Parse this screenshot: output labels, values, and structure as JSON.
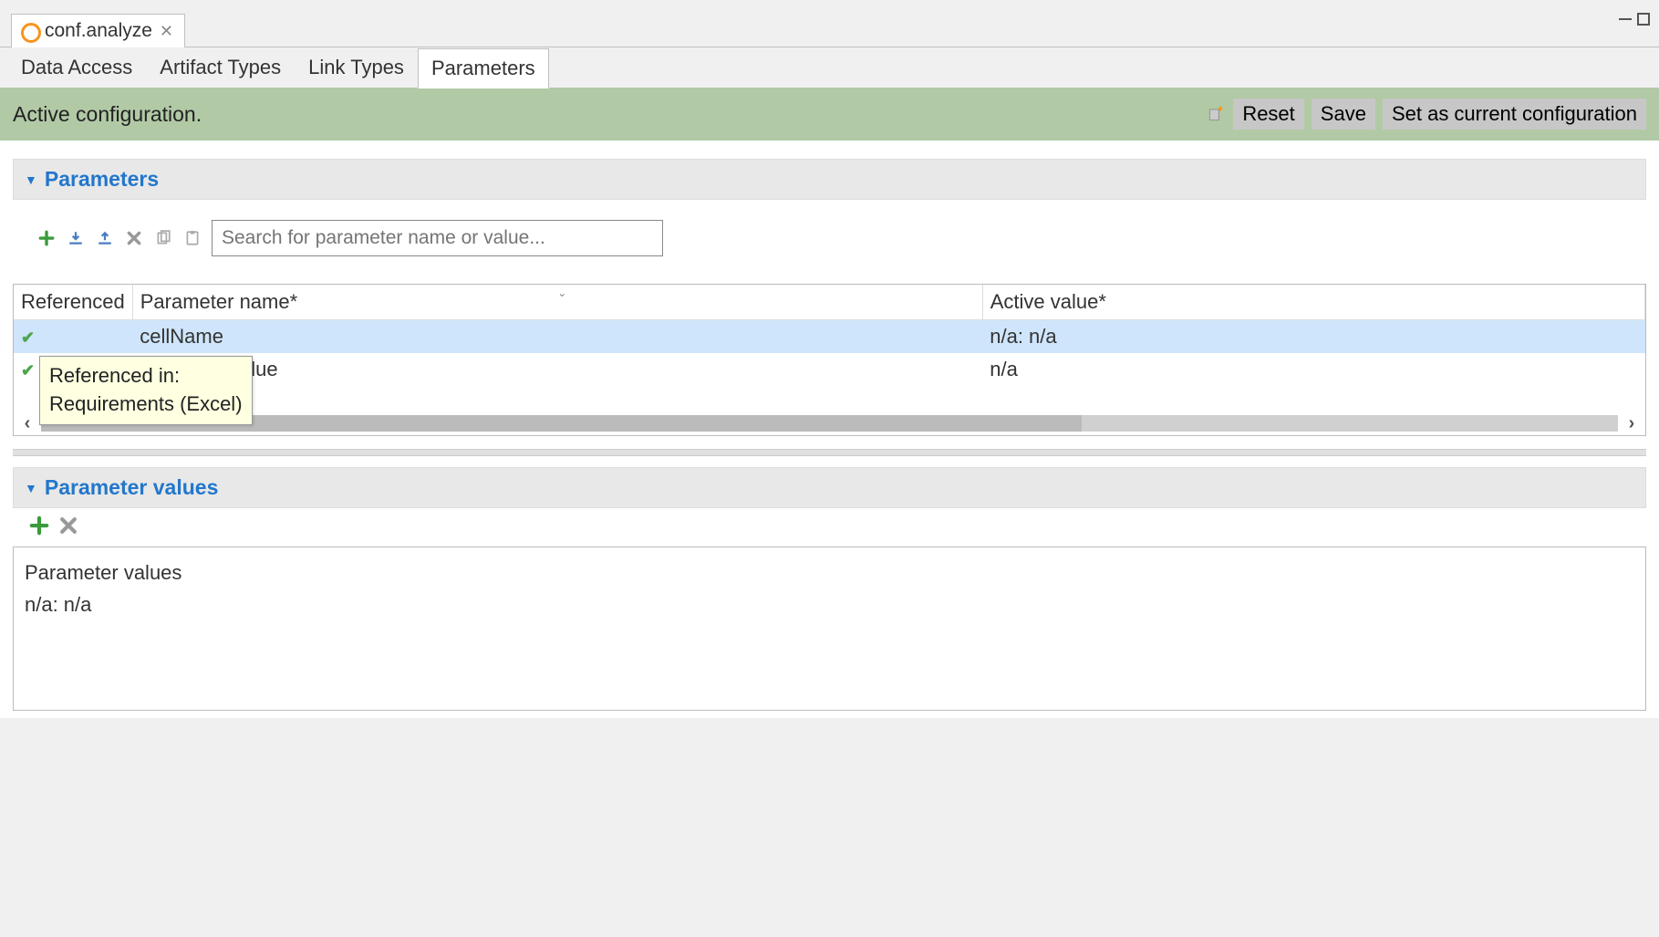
{
  "editor": {
    "tab_title": "conf.analyze"
  },
  "window_icons": {
    "minimize": "minimize",
    "maximize": "maximize"
  },
  "subtabs": [
    {
      "label": "Data Access",
      "active": false
    },
    {
      "label": "Artifact Types",
      "active": false
    },
    {
      "label": "Link Types",
      "active": false
    },
    {
      "label": "Parameters",
      "active": true
    }
  ],
  "status": {
    "message": "Active configuration.",
    "buttons": {
      "reset": "Reset",
      "save": "Save",
      "set_current": "Set as current configuration"
    },
    "new_icon": "new-config-icon"
  },
  "parameters_section": {
    "title": "Parameters",
    "toolbar": {
      "add": "add-icon",
      "import": "import-icon",
      "export": "export-icon",
      "delete": "delete-icon",
      "copy": "copy-icon",
      "paste": "paste-icon",
      "search_placeholder": "Search for parameter name or value..."
    },
    "columns": {
      "referenced": "Referenced",
      "name": "Parameter name*",
      "active_value": "Active value*"
    },
    "rows": [
      {
        "referenced": true,
        "name": "cellName",
        "active_value": "n/a: n/a",
        "selected": true
      },
      {
        "referenced": true,
        "name": "lue",
        "active_value": "n/a",
        "selected": false
      }
    ],
    "tooltip": {
      "line1": "Referenced in:",
      "line2": "Requirements (Excel)"
    }
  },
  "values_section": {
    "title": "Parameter values",
    "toolbar": {
      "add": "add-icon",
      "delete": "delete-icon"
    },
    "header_label": "Parameter values",
    "current_value": "n/a: n/a"
  }
}
